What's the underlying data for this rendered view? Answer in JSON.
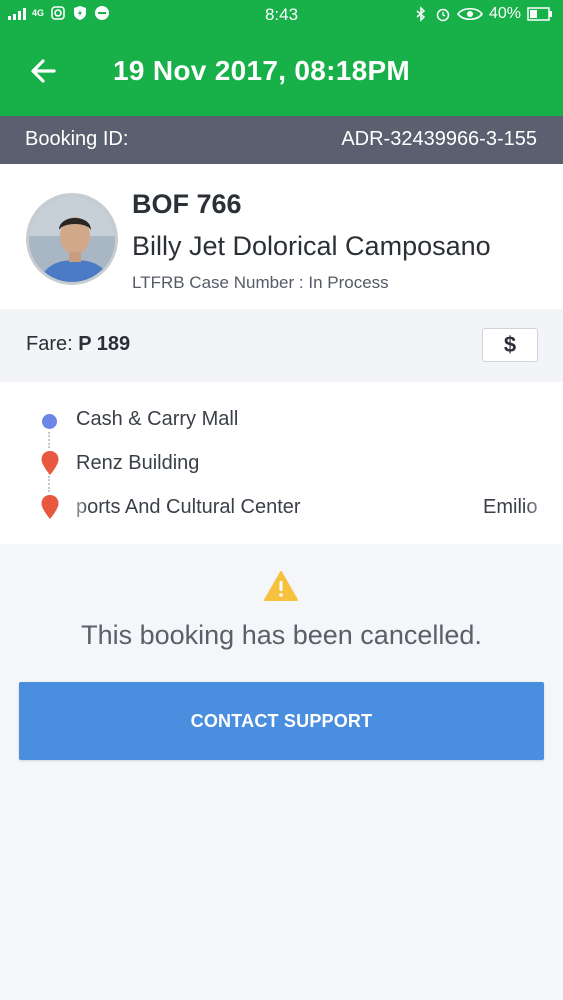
{
  "status_bar": {
    "network": "4G",
    "time": "8:43",
    "battery": "40%",
    "icons": [
      "signal-icon",
      "instagram-icon",
      "shield-icon",
      "app-icon",
      "bluetooth-icon",
      "alarm-icon",
      "eye-icon",
      "battery-icon"
    ]
  },
  "header": {
    "title": "19 Nov 2017, 08:18PM",
    "back_icon": "arrow-left-icon",
    "color": "#17b049"
  },
  "booking": {
    "label": "Booking ID:",
    "id": "ADR-32439966-3-155"
  },
  "driver": {
    "plate": "BOF 766",
    "name": "Billy Jet Dolorical Camposano",
    "case_number": "LTFRB Case Number : In Process"
  },
  "fare": {
    "label": "Fare:",
    "amount": "P 189",
    "button_icon": "$"
  },
  "route": {
    "stops": [
      {
        "label": "Cash & Carry Mall",
        "type": "pickup"
      },
      {
        "label": "Renz Building",
        "type": "dropoff"
      },
      {
        "label": "ports And Cultural Center",
        "extra": "Emilio",
        "type": "dropoff"
      }
    ]
  },
  "status": {
    "message": "This booking has been cancelled.",
    "icon": "warning-icon"
  },
  "actions": {
    "contact_support": "CONTACT SUPPORT",
    "color": "#4a8ee0"
  }
}
